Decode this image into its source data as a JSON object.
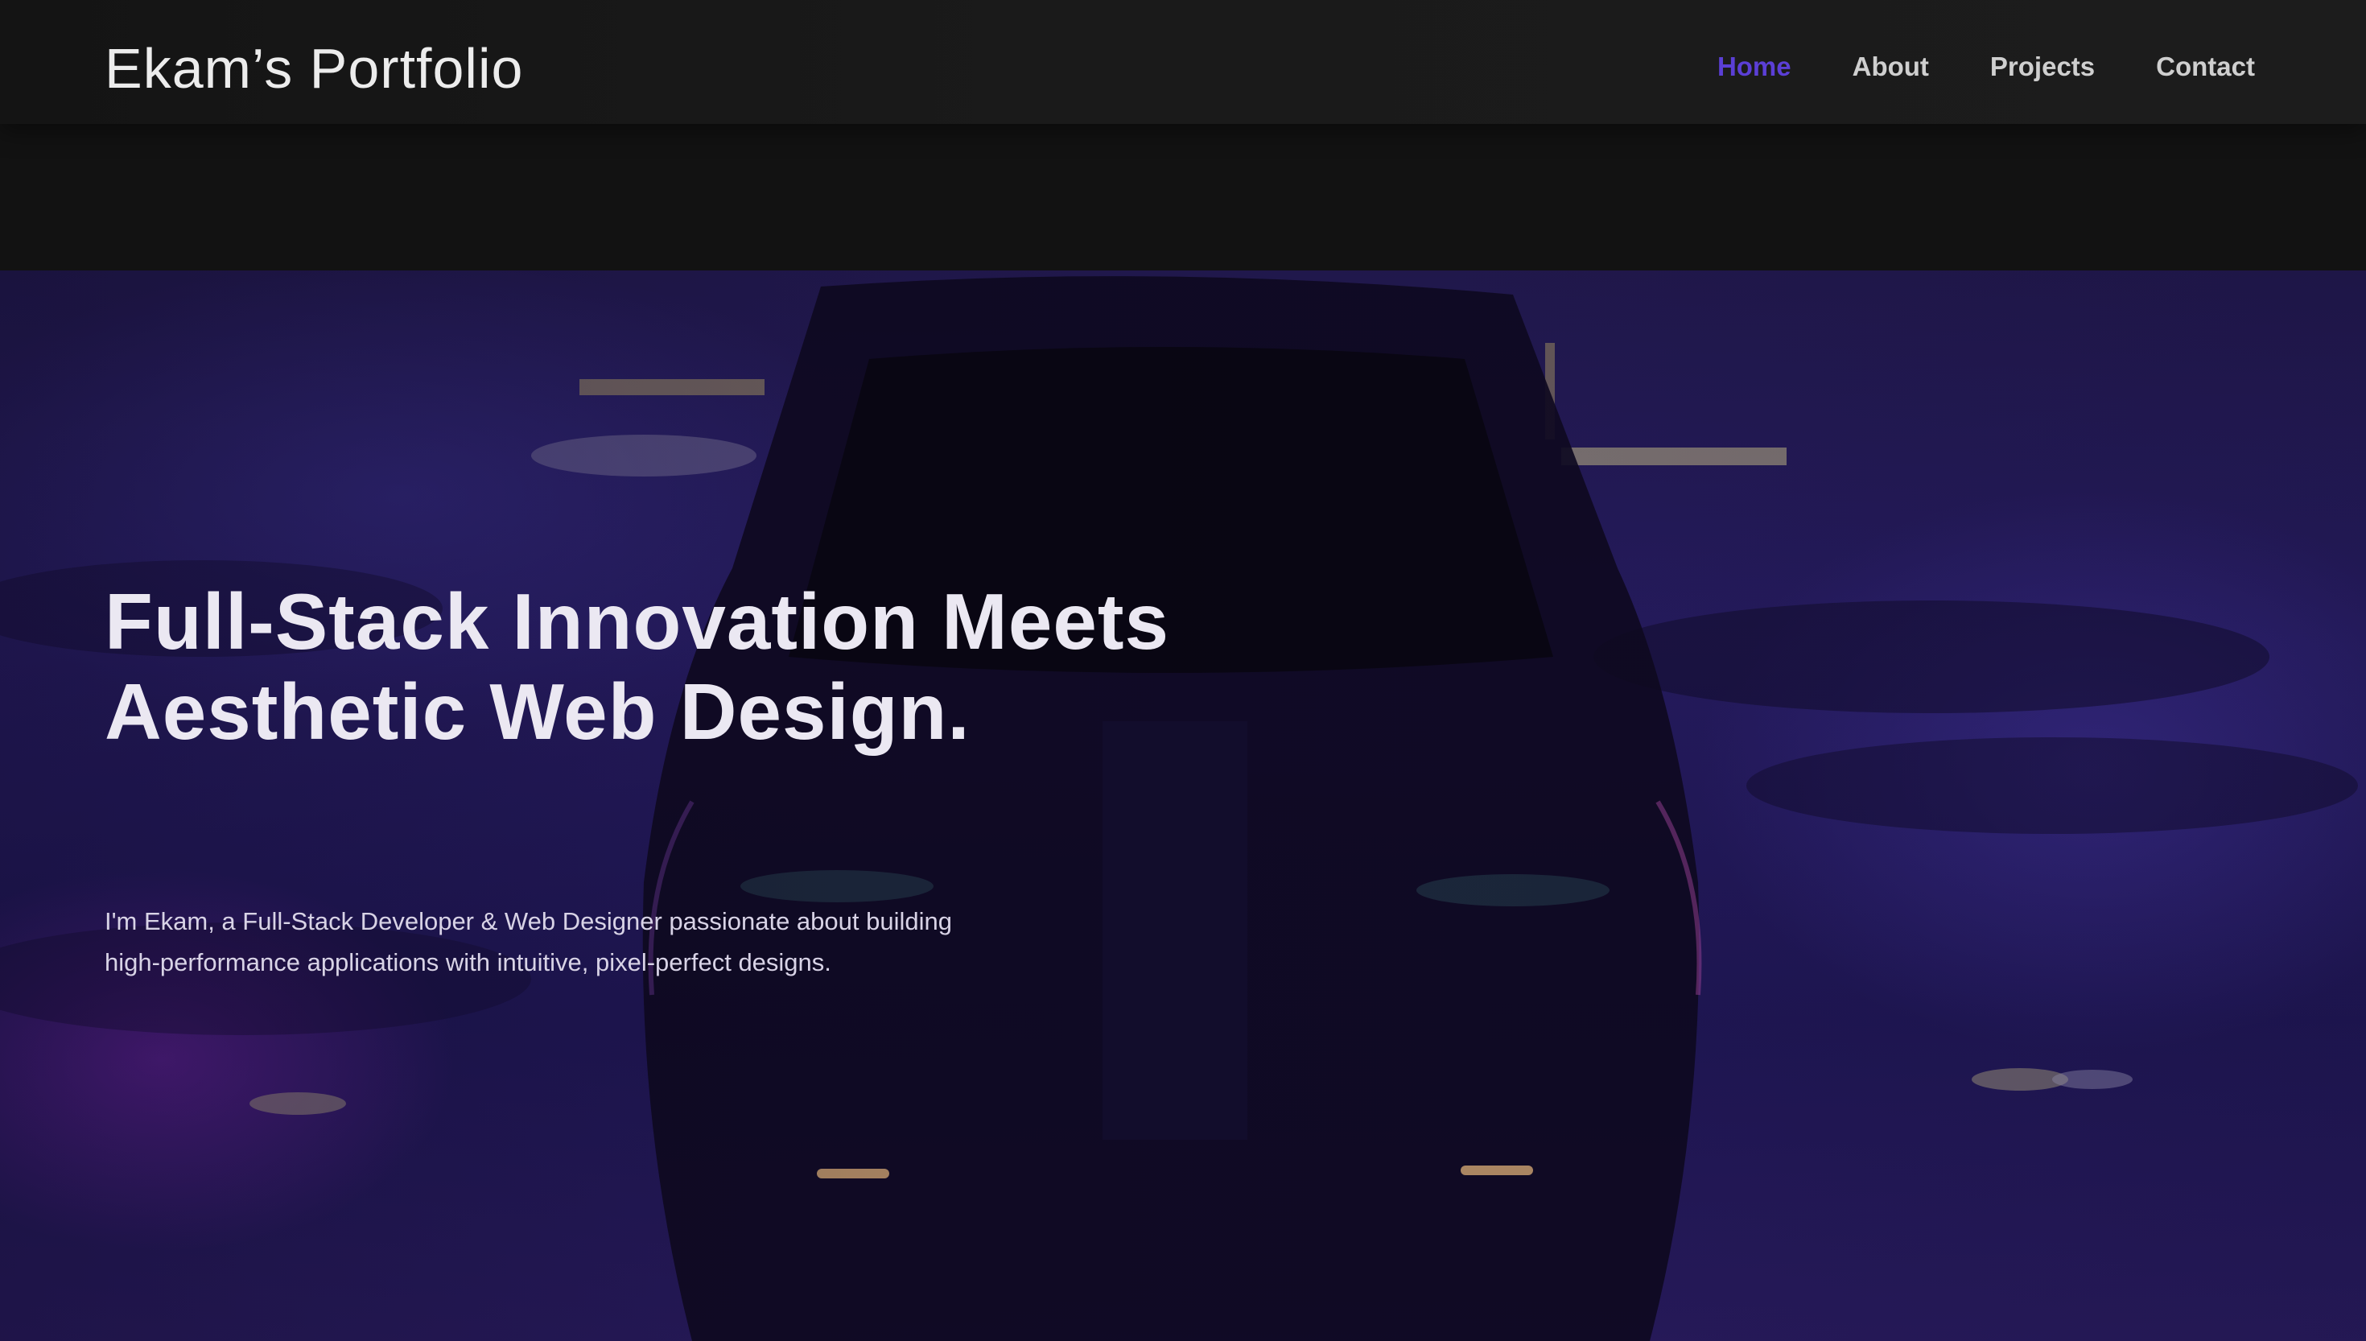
{
  "brand": {
    "title": "Ekam’s Portfolio"
  },
  "nav": {
    "items": [
      {
        "label": "Home",
        "active": true
      },
      {
        "label": "About",
        "active": false
      },
      {
        "label": "Projects",
        "active": false
      },
      {
        "label": "Contact",
        "active": false
      }
    ]
  },
  "hero": {
    "headline_line1": "Full-Stack Innovation Meets",
    "headline_line2": "Aesthetic Web Design.",
    "intro": "I'm Ekam, a Full-Stack Developer & Web Designer passionate about building high-performance applications with intuitive, pixel-perfect designs.",
    "background_icon": "car-night-photo"
  },
  "colors": {
    "accent": "#5b3fd6",
    "nav_text": "#cfcfcf",
    "page_bg": "#121212",
    "hero_tint": "#281d66"
  }
}
